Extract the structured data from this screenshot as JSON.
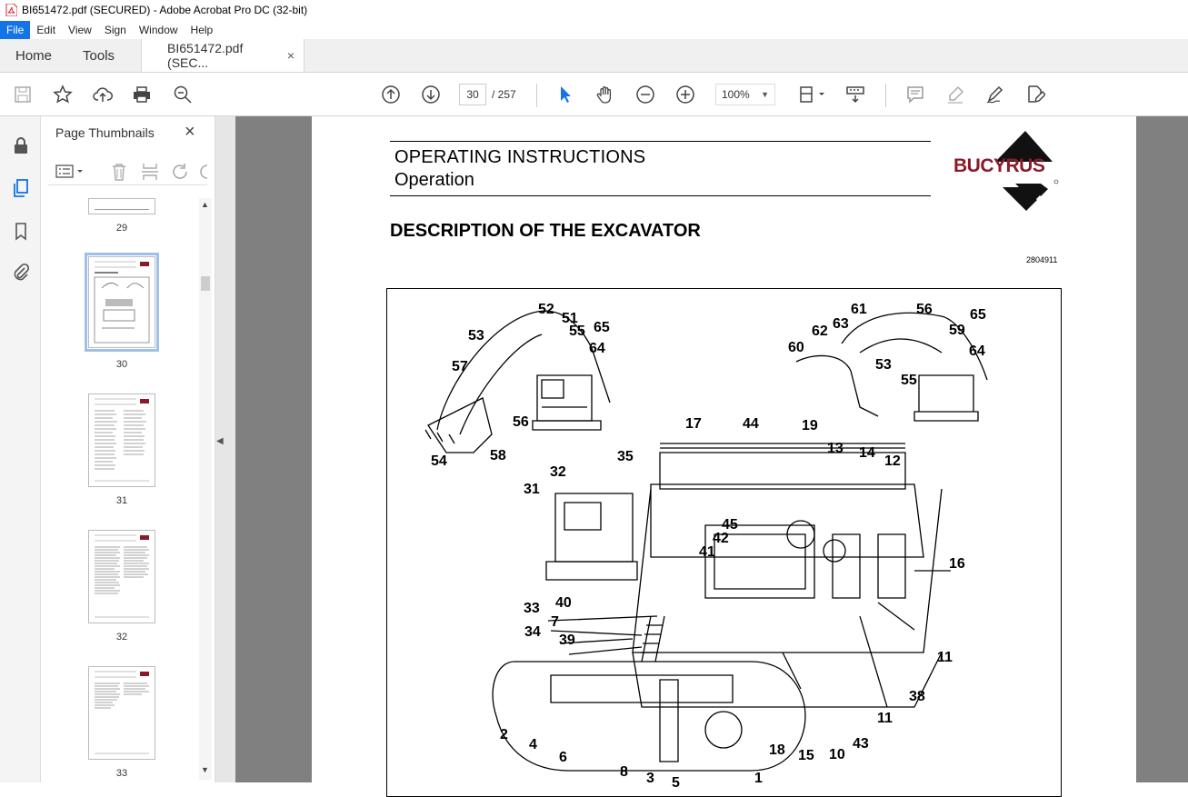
{
  "window": {
    "title": "BI651472.pdf (SECURED) - Adobe Acrobat Pro DC (32-bit)"
  },
  "menu": [
    "File",
    "Edit",
    "View",
    "Sign",
    "Window",
    "Help"
  ],
  "tabs": {
    "home": "Home",
    "tools": "Tools",
    "document": "BI651472.pdf (SEC...",
    "close": "×"
  },
  "toolbar": {
    "current_page": "30",
    "total_pages": "/ 257",
    "zoom": "100%"
  },
  "thumbnails_panel": {
    "title": "Page Thumbnails",
    "close": "×",
    "pages": [
      {
        "label": "29"
      },
      {
        "label": "30",
        "selected": true
      },
      {
        "label": "31"
      },
      {
        "label": "32"
      },
      {
        "label": "33"
      }
    ]
  },
  "document": {
    "header_line1": "OPERATING INSTRUCTIONS",
    "header_line2": "Operation",
    "logo": "BUCYRUS",
    "heading": "DESCRIPTION OF THE EXCAVATOR",
    "reference": "2804911",
    "callouts": [
      "52",
      "51",
      "55",
      "65",
      "53",
      "64",
      "57",
      "56",
      "54",
      "58",
      "61",
      "56",
      "65",
      "62",
      "63",
      "60",
      "59",
      "53",
      "64",
      "55",
      "17",
      "44",
      "19",
      "13",
      "14",
      "12",
      "32",
      "35",
      "31",
      "45",
      "42",
      "41",
      "16",
      "33",
      "40",
      "7",
      "34",
      "39",
      "11",
      "38",
      "11",
      "2",
      "4",
      "6",
      "8",
      "3",
      "5",
      "1",
      "18",
      "15",
      "10",
      "43"
    ]
  },
  "colors": {
    "accent": "#1473e6",
    "logo": "#8b1a2b",
    "viewer_bg": "#808080"
  }
}
